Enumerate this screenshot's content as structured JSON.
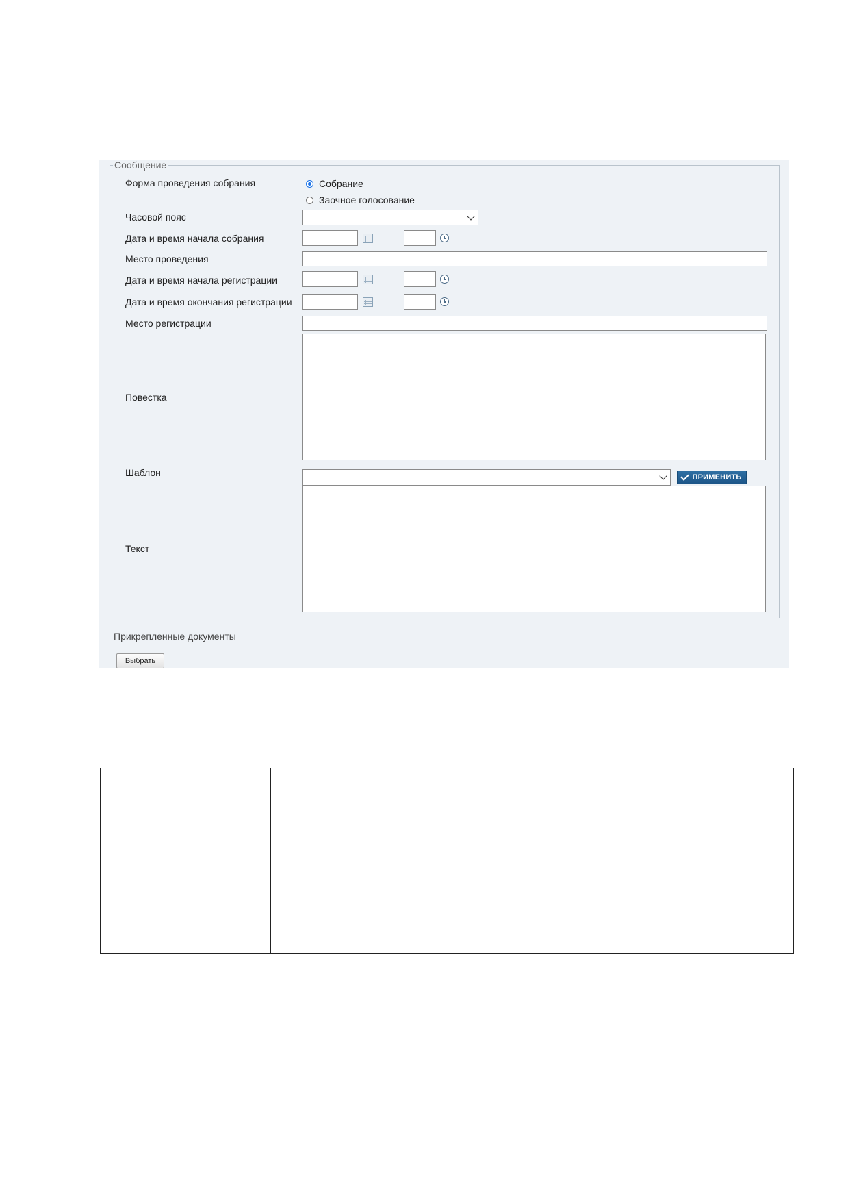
{
  "form": {
    "legend": "Сообщение",
    "labels": {
      "meeting_form": "Форма проведения собрания",
      "timezone": "Часовой пояс",
      "meeting_start": "Дата и время начала собрания",
      "venue": "Место проведения",
      "reg_start": "Дата и время начала регистрации",
      "reg_end": "Дата и время окончания регистрации",
      "reg_place": "Место регистрации",
      "agenda": "Повестка",
      "template": "Шаблон",
      "text": "Текст"
    },
    "radio_options": [
      {
        "label": "Собрание",
        "selected": true
      },
      {
        "label": "Заочное голосование",
        "selected": false
      }
    ],
    "timezone_value": "",
    "template_value": "",
    "apply_label": "ПРИМЕНИТЬ"
  },
  "attachments": {
    "label": "Прикрепленные документы",
    "choose_label": "Выбрать"
  },
  "colors": {
    "panel_bg": "#eef2f6",
    "apply_button": "#1d5588",
    "radio_accent": "#1a73e8"
  }
}
